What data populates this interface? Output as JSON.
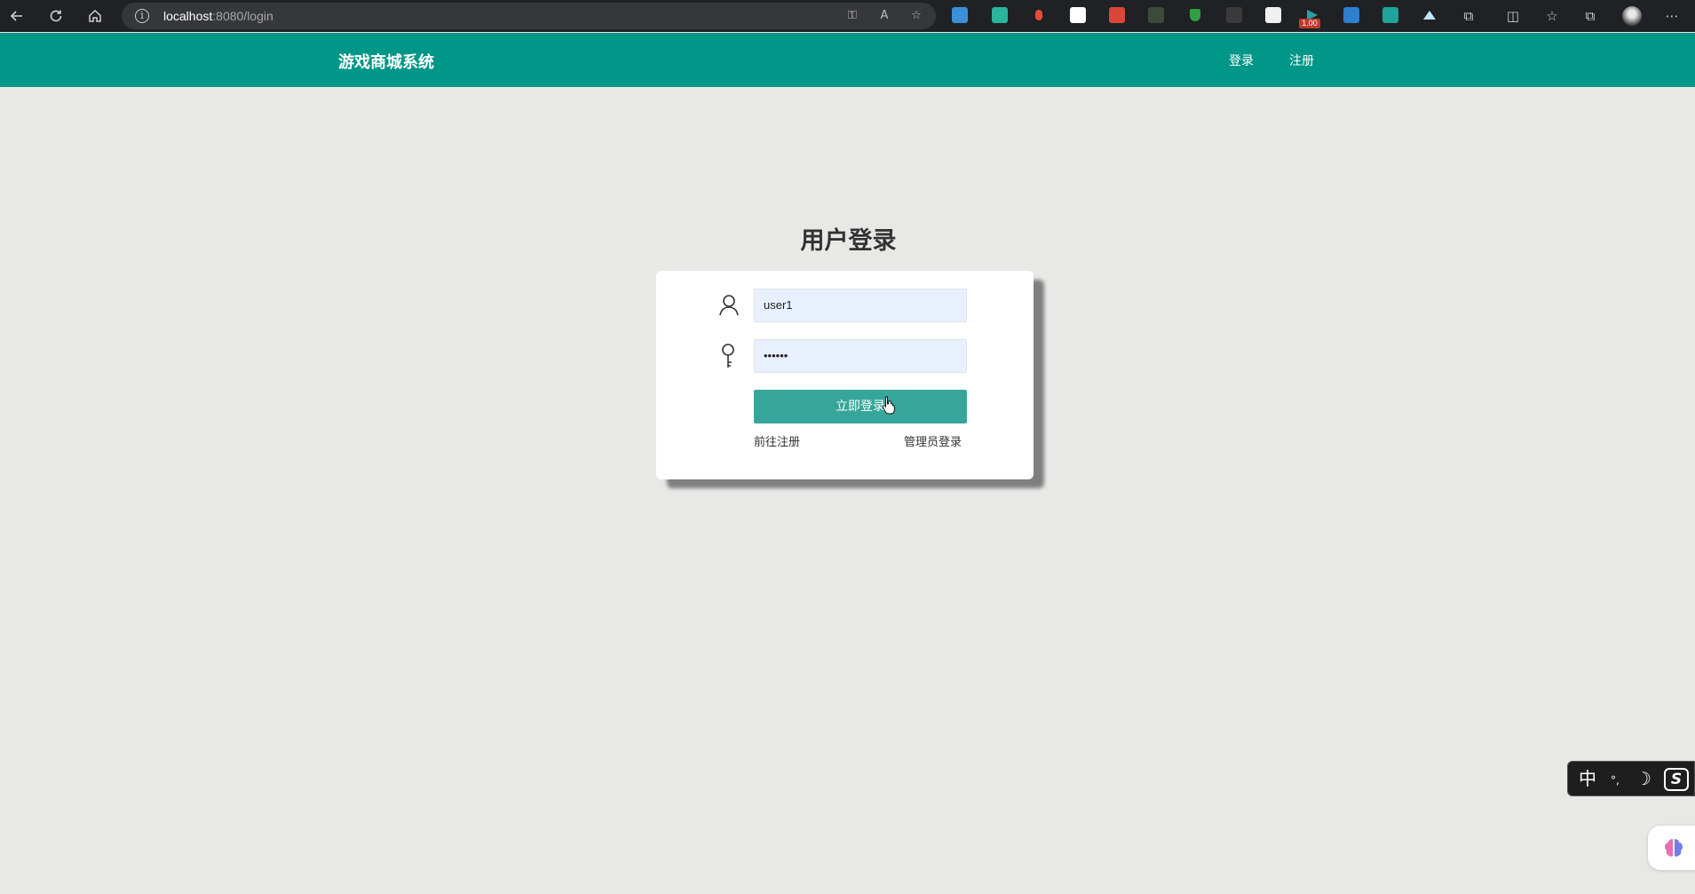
{
  "browser": {
    "url_host": "localhost",
    "url_path": ":8080/login",
    "badge": "1.00"
  },
  "header": {
    "brand": "游戏商城系统",
    "nav": {
      "login": "登录",
      "register": "注册"
    }
  },
  "login": {
    "title": "用户登录",
    "username_value": "user1",
    "password_value": "••••••",
    "submit_label": "立即登录",
    "register_link": "前往注册",
    "admin_link": "管理员登录"
  },
  "ime": {
    "lang": "中",
    "punct": "°,",
    "moon": "☽",
    "logo": "S"
  },
  "colors": {
    "primary": "#009688",
    "button": "#36a69a",
    "background": "#e8e8e7",
    "input_bg": "#e8f0fe"
  }
}
